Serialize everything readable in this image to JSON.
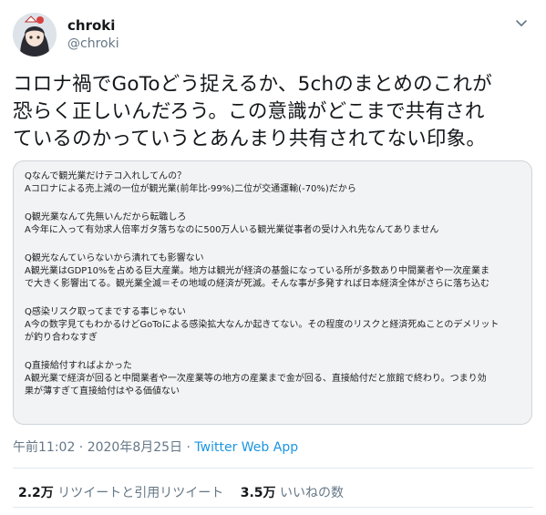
{
  "user": {
    "display_name": "chroki",
    "handle": "@chroki",
    "avatar_icon": "anime-character-avatar"
  },
  "tweet": {
    "lines": [
      "コロナ禍でGoToどう捉えるか、5chのまとめのこれが",
      "恐らく正しいんだろう。この意識がどこまで共有され",
      "ているのかっていうとあんまり共有されてない印象。"
    ]
  },
  "card": {
    "items": [
      {
        "lines": [
          "Qなんで観光業だけテコ入れしてんの？",
          "Aコロナによる売上減の一位が観光業(前年比-99%)二位が交通運輸(-70%)だから"
        ]
      },
      {
        "lines": [
          "Q観光業なんて先無いんだから転職しろ",
          "A今年に入って有効求人倍率ガタ落ちなのに500万人いる観光業従事者の受け入れ先なんてありません"
        ]
      },
      {
        "lines": [
          "Q観光なんていらないから潰れても影響ない",
          "A観光業はGDP10%を占める巨大産業。地方は観光が経済の基盤になっている所が多数あり中間業者や一次産業ま",
          "で大きく影響出てる。観光業全滅＝その地域の経済が死滅。そんな事が多発すれば日本経済全体がさらに落ち込む"
        ]
      },
      {
        "lines": [
          "Q感染リスク取ってまでする事じゃない",
          "A今の数字見てもわかるけどGoToによる感染拡大なんか起きてない。その程度のリスクと経済死ぬことのデメリット",
          "が釣り合わなすぎ"
        ]
      },
      {
        "lines": [
          "Q直接給付すればよかった",
          "A観光業で経済が回ると中間業者や一次産業等の地方の産業まで金が回る、直接給付だと旅館で終わり。つまり効",
          "果が薄すぎて直接給付はやる価値ない"
        ]
      }
    ]
  },
  "meta": {
    "timestamp": "午前11:02 · 2020年8月25日",
    "separator": " · ",
    "source": "Twitter Web App"
  },
  "stats": {
    "retweets_count": "2.2万",
    "retweets_label": "リツイートと引用リツイート",
    "likes_count": "3.5万",
    "likes_label": "いいねの数"
  },
  "colors": {
    "link": "#1b95e0",
    "secondary_text": "#657786",
    "primary_text": "#14171a"
  },
  "icons": {
    "more": "chevron-down-icon"
  }
}
